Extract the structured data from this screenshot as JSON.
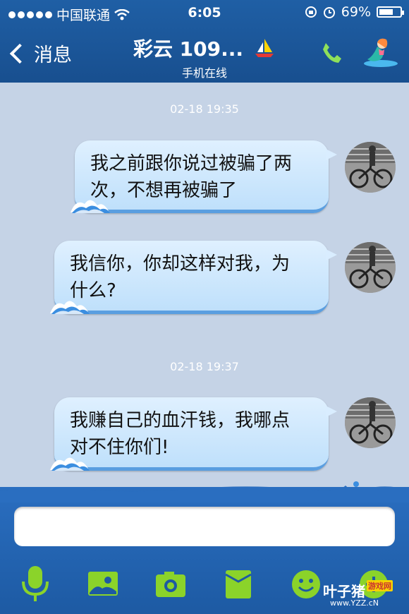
{
  "status_bar": {
    "carrier": "中国联通",
    "time": "6:05",
    "battery": "69%",
    "battery_level": 0.69
  },
  "nav": {
    "back_label": "消息",
    "title": "彩云 109...",
    "subtitle": "手机在线"
  },
  "messages": [
    {
      "timestamp": "02-18 19:35",
      "lines": [
        "我之前跟你说过被骗了两",
        "次，不想再被骗了"
      ]
    },
    {
      "lines": [
        "我信你，你却这样对我，为",
        "什么?"
      ]
    },
    {
      "timestamp": "02-18 19:37",
      "lines": [
        "我赚自己的血汗钱，我哪点",
        "对不住你们!"
      ]
    }
  ],
  "input": {
    "value": "",
    "placeholder": ""
  },
  "toolbar": {
    "icons": [
      "microphone-icon",
      "photo-icon",
      "camera-icon",
      "folder-icon",
      "emoji-icon",
      "plus-icon"
    ]
  },
  "watermark": {
    "brand": "叶子猪",
    "tag": "游戏网",
    "url": "www.YZZ.cN"
  },
  "colors": {
    "header": "#1f5fa5",
    "chat_bg": "#c5d3e6",
    "bubble": "#cfe8fd",
    "icon_green": "#8bd32a"
  }
}
